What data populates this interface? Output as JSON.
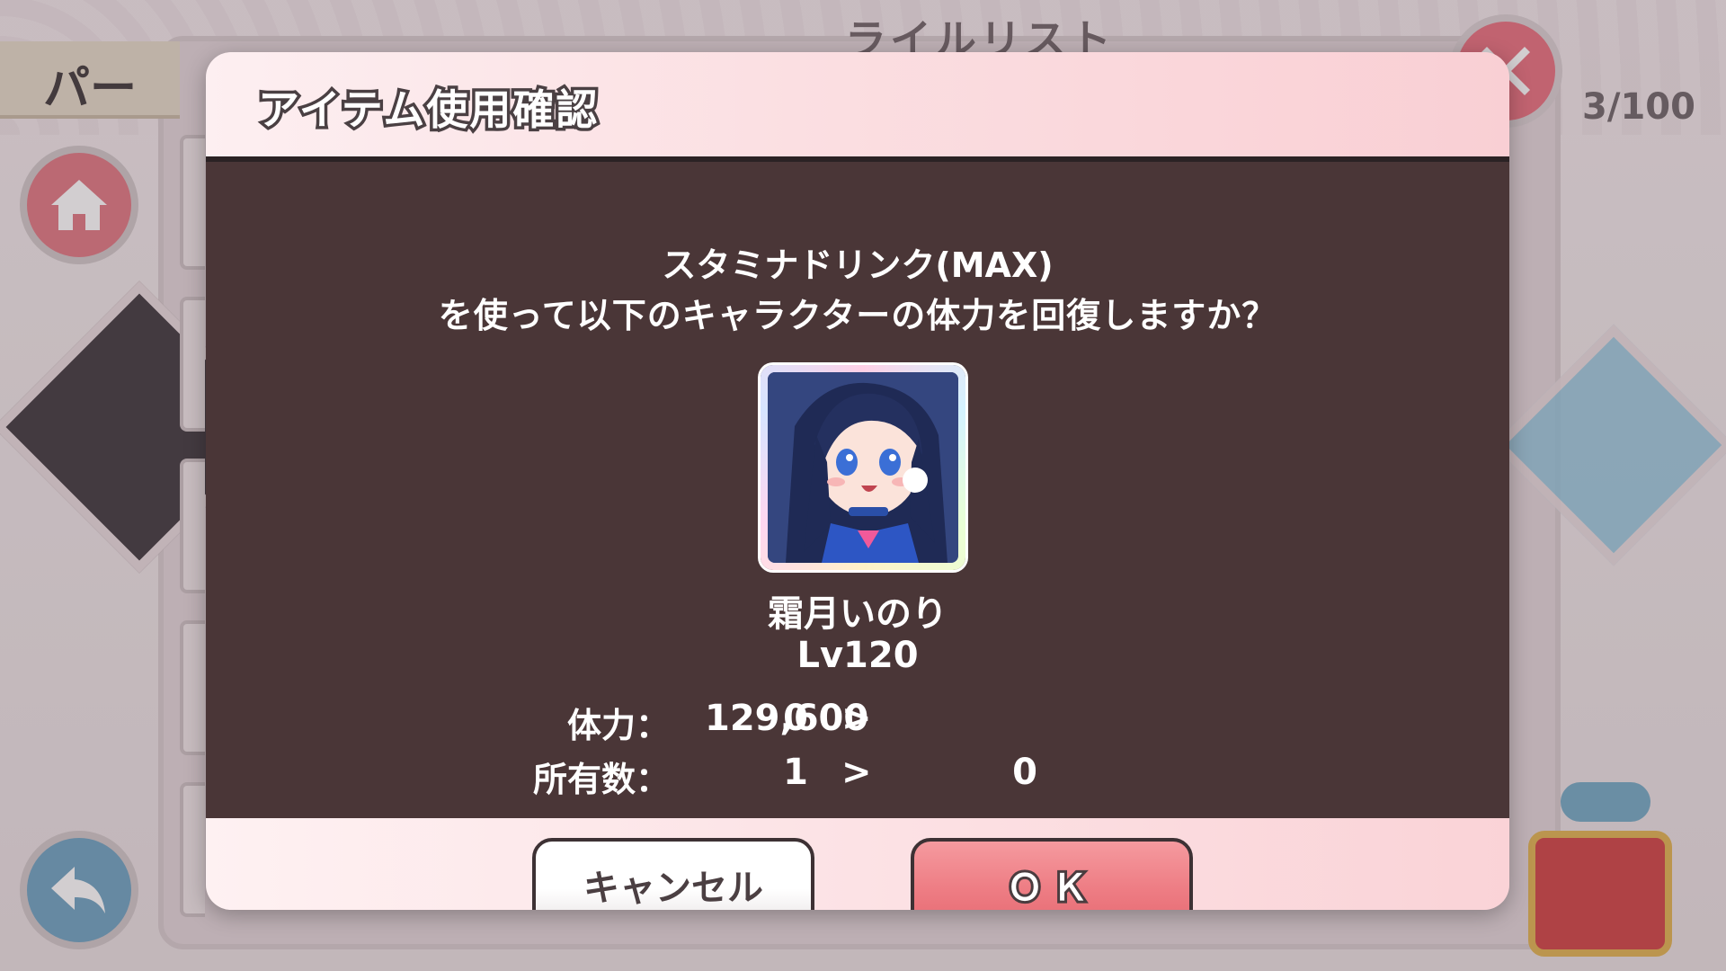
{
  "background": {
    "list_title": "ライルリスト",
    "tab_label": "パー",
    "counter": "3/100",
    "home_icon": "home-icon",
    "back_icon": "back-arrow-icon",
    "close_icon": "close-icon"
  },
  "dialog": {
    "title": "アイテム使用確認",
    "item_name": "スタミナドリンク(MAX)",
    "question": "を使って以下のキャラクターの体力を回復しますか？",
    "character": {
      "name": "霜月いのり",
      "level": "Lv120"
    },
    "stats": [
      {
        "label": "体力：",
        "before": "0",
        "arrow": ">",
        "after": "129,600"
      },
      {
        "label": "所有数：",
        "before": "1",
        "arrow": ">",
        "after": "0"
      }
    ],
    "buttons": {
      "cancel": "キャンセル",
      "ok": "ＯＫ"
    }
  },
  "colors": {
    "body_bg": "#4a3637",
    "ok_button": "#ee7d84",
    "close_button": "#e86b7a"
  }
}
